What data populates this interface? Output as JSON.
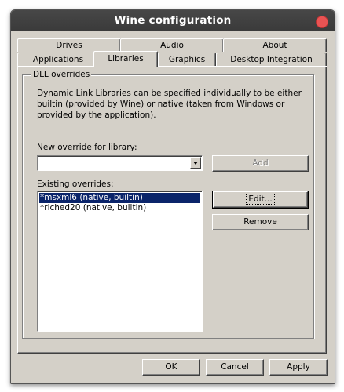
{
  "window": {
    "title": "Wine configuration"
  },
  "tabs": {
    "row_back": [
      "Drives",
      "Audio",
      "About"
    ],
    "row_front": [
      "Applications",
      "Libraries",
      "Graphics",
      "Desktop Integration"
    ],
    "active": "Libraries"
  },
  "dll": {
    "group_label": "DLL overrides",
    "description": "Dynamic Link Libraries can be specified individually to be either builtin (provided by Wine) or native (taken from Windows or provided by the application).",
    "new_label": "New override for library:",
    "new_value": "",
    "add_label": "Add",
    "existing_label": "Existing overrides:",
    "overrides": [
      "*msxml6 (native, builtin)",
      "*riched20 (native, builtin)"
    ],
    "selected_index": 0,
    "edit_label": "Edit...",
    "remove_label": "Remove"
  },
  "footer": {
    "ok": "OK",
    "cancel": "Cancel",
    "apply": "Apply"
  },
  "colors": {
    "selection": "#0a246a",
    "titlebar": "#3f3f3f",
    "close": "#e95353",
    "face": "#d4d0c8"
  }
}
